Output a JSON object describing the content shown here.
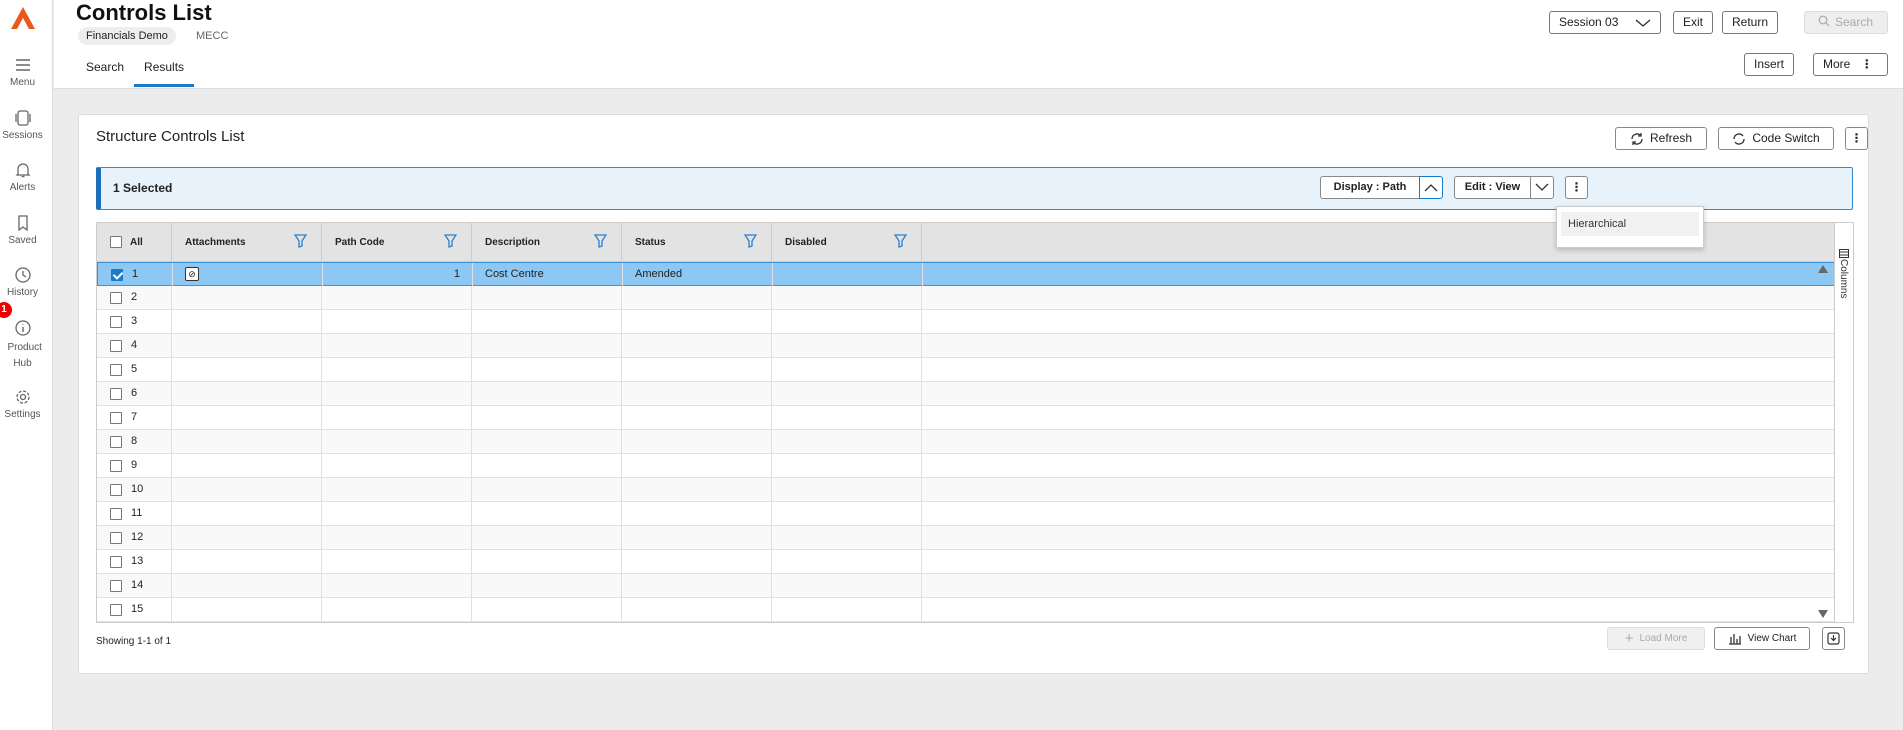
{
  "rail": {
    "items": [
      {
        "label": "Menu"
      },
      {
        "label": "Sessions"
      },
      {
        "label": "Alerts"
      },
      {
        "label": "Saved"
      },
      {
        "label": "History"
      },
      {
        "label": "Product Hub"
      },
      {
        "label": "Settings"
      }
    ],
    "badge": "1"
  },
  "header": {
    "title": "Controls List",
    "chip": "Financials Demo",
    "subtag": "MECC",
    "tabs": [
      {
        "label": "Search"
      },
      {
        "label": "Results"
      }
    ],
    "session_label": "Session 03",
    "exit_label": "Exit",
    "return_label": "Return",
    "search_label": "Search",
    "insert_label": "Insert",
    "more_label": "More"
  },
  "card": {
    "title": "Structure Controls List",
    "refresh_label": "Refresh",
    "code_switch_label": "Code Switch",
    "selected_text": "1 Selected",
    "display_label": "Display : Path",
    "edit_label": "Edit : View",
    "dropdown_option": "Hierarchical",
    "footer_text": "Showing 1-1 of 1",
    "load_more_label": "Load More",
    "view_chart_label": "View Chart"
  },
  "grid": {
    "columns": {
      "all": "All",
      "attachments": "Attachments",
      "path_code": "Path Code",
      "description": "Description",
      "status": "Status",
      "disabled": "Disabled"
    },
    "side_panel": "Columns",
    "rows": [
      {
        "num": "1",
        "path_code": "1",
        "description": "Cost Centre",
        "status": "Amended",
        "selected": true
      },
      {
        "num": "2"
      },
      {
        "num": "3"
      },
      {
        "num": "4"
      },
      {
        "num": "5"
      },
      {
        "num": "6"
      },
      {
        "num": "7"
      },
      {
        "num": "8"
      },
      {
        "num": "9"
      },
      {
        "num": "10"
      },
      {
        "num": "11"
      },
      {
        "num": "12"
      },
      {
        "num": "13"
      },
      {
        "num": "14"
      },
      {
        "num": "15"
      }
    ]
  },
  "colors": {
    "accent": "#1a7bc8",
    "selected_row": "#8dc7f3",
    "logo": "#e8591a",
    "filter_icon": "#2a7fd0",
    "badge": "#e00000"
  }
}
